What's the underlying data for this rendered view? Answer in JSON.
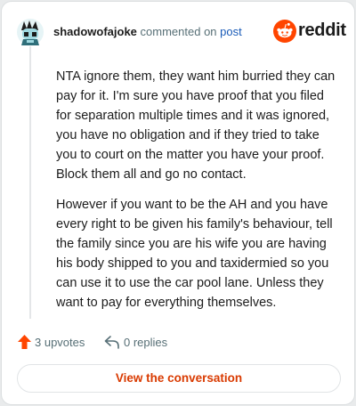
{
  "header": {
    "username": "shadowofajoke",
    "action_text": "commented on",
    "post_link": "post",
    "logo_text": "reddit"
  },
  "comment": {
    "paragraphs": [
      "NTA ignore them, they want him burried they can pay for it. I'm sure you have proof that you filed for separation multiple times and it was ignored, you have no obligation and if they tried to take you to court on the matter you have your proof. Block them all and go no contact.",
      "However if you want to be the AH and you have every right to be given his family's behaviour, tell the family since you are his wife you are having his body shipped to you and taxidermied so you can use it to use the car pool lane. Unless they want to pay for everything themselves."
    ]
  },
  "actions": {
    "upvotes_label": "3 upvotes",
    "replies_label": "0 replies"
  },
  "cta": {
    "label": "View the conversation"
  },
  "colors": {
    "accent": "#ff4500",
    "link": "#1a5bb8",
    "cta_text": "#d93a00"
  },
  "icons": [
    "avatar",
    "reddit-logo-icon",
    "upvote-icon",
    "reply-icon"
  ]
}
